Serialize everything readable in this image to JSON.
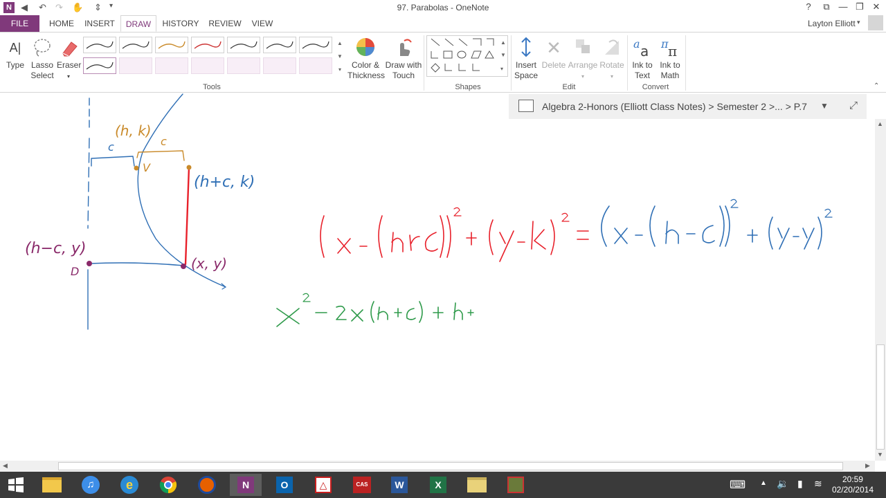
{
  "window": {
    "title": "97. Parabolas - OneNote",
    "help": "?",
    "user": "Layton Elliott"
  },
  "tabs": [
    "FILE",
    "HOME",
    "INSERT",
    "DRAW",
    "HISTORY",
    "REVIEW",
    "VIEW"
  ],
  "ribbon": {
    "type_label": "Type",
    "lasso_label_1": "Lasso",
    "lasso_label_2": "Select",
    "eraser_label": "Eraser",
    "color_label_1": "Color &",
    "color_label_2": "Thickness",
    "touch_label_1": "Draw with",
    "touch_label_2": "Touch",
    "insert_space_1": "Insert",
    "insert_space_2": "Space",
    "delete_label": "Delete",
    "arrange_label": "Arrange",
    "rotate_label": "Rotate",
    "ink_text_1": "Ink to",
    "ink_text_2": "Text",
    "ink_math_1": "Ink to",
    "ink_math_2": "Math",
    "groups": {
      "tools": "Tools",
      "shapes": "Shapes",
      "edit": "Edit",
      "convert": "Convert"
    }
  },
  "notebook_path": "Algebra 2-Honors (Elliott Class Notes) > Semester 2 >...   > P.7",
  "clock": {
    "time": "20:59",
    "date": "02/20/2014"
  },
  "colors": {
    "accent": "#80397b",
    "ink_red": "#e8202a",
    "ink_blue": "#2f6fb5",
    "ink_orange": "#c98a2a",
    "ink_green": "#2e9a4a",
    "ink_purple": "#8a2a6a"
  },
  "icons": [
    "back-icon",
    "undo-icon",
    "redo-icon",
    "touch-mode-icon",
    "help-icon",
    "restore-icon",
    "minimize-icon",
    "maximize-icon",
    "close-icon",
    "expand-icon",
    "chevron-down-icon"
  ]
}
